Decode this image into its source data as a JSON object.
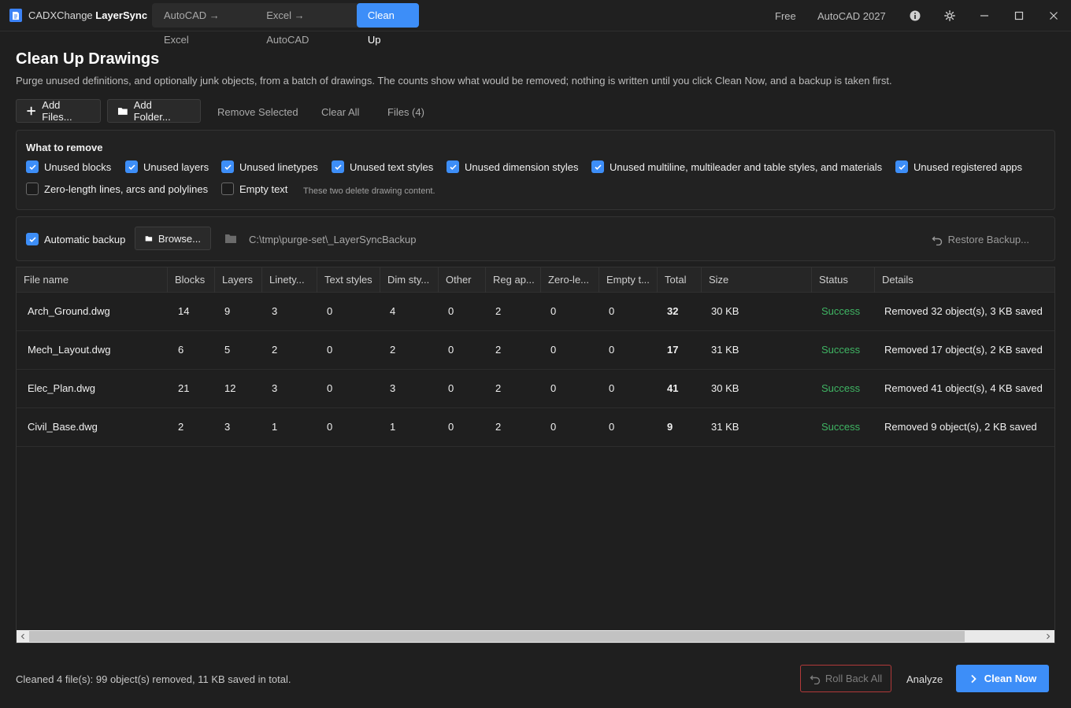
{
  "app": {
    "title_prefix": "CADXChange",
    "title_suffix": "LayerSync",
    "tabs": [
      {
        "label": "AutoCAD → Excel",
        "active": false
      },
      {
        "label": "Excel → AutoCAD",
        "active": false
      },
      {
        "label": "Clean Up",
        "active": true
      }
    ],
    "license": "Free",
    "autocad_version": "AutoCAD 2027",
    "accent_color": "#3d8ef8"
  },
  "header": {
    "title": "Clean Up Drawings",
    "subtitle": "Purge unused definitions, and optionally junk objects, from a batch of drawings. The counts show what would be removed; nothing is written until you click Clean Now, and a backup is taken first."
  },
  "toolbar": {
    "add_files": "Add Files...",
    "add_folder": "Add Folder...",
    "remove_selected": "Remove Selected",
    "clear_all": "Clear All",
    "files_count": "Files (4)"
  },
  "options": {
    "heading": "What to remove",
    "items": [
      {
        "label": "Unused blocks",
        "checked": true
      },
      {
        "label": "Unused layers",
        "checked": true
      },
      {
        "label": "Unused linetypes",
        "checked": true
      },
      {
        "label": "Unused text styles",
        "checked": true
      },
      {
        "label": "Unused dimension styles",
        "checked": true
      },
      {
        "label": "Unused multiline, multileader and table styles, and materials",
        "checked": true
      },
      {
        "label": "Unused registered apps",
        "checked": true
      },
      {
        "label": "Zero-length lines, arcs and polylines",
        "checked": false
      },
      {
        "label": "Empty text",
        "checked": false
      }
    ],
    "hint": "These two delete drawing content."
  },
  "backup": {
    "label": "Automatic backup",
    "checked": true,
    "browse": "Browse...",
    "path": "C:\\tmp\\purge-set\\_LayerSyncBackup",
    "restore": "Restore Backup..."
  },
  "table": {
    "columns": [
      "File name",
      "Blocks",
      "Layers",
      "Linety...",
      "Text styles",
      "Dim sty...",
      "Other",
      "Reg ap...",
      "Zero-le...",
      "Empty t...",
      "Total",
      "Size",
      "Status",
      "Details"
    ],
    "rows": [
      {
        "file": "Arch_Ground.dwg",
        "blocks": "14",
        "layers": "9",
        "linetypes": "3",
        "text_styles": "0",
        "dim_styles": "4",
        "other": "0",
        "reg_apps": "2",
        "zero_length": "0",
        "empty_text": "0",
        "total": "32",
        "size": "30 KB",
        "status": "Success",
        "details": "Removed 32 object(s), 3 KB saved"
      },
      {
        "file": "Mech_Layout.dwg",
        "blocks": "6",
        "layers": "5",
        "linetypes": "2",
        "text_styles": "0",
        "dim_styles": "2",
        "other": "0",
        "reg_apps": "2",
        "zero_length": "0",
        "empty_text": "0",
        "total": "17",
        "size": "31 KB",
        "status": "Success",
        "details": "Removed 17 object(s), 2 KB saved"
      },
      {
        "file": "Elec_Plan.dwg",
        "blocks": "21",
        "layers": "12",
        "linetypes": "3",
        "text_styles": "0",
        "dim_styles": "3",
        "other": "0",
        "reg_apps": "2",
        "zero_length": "0",
        "empty_text": "0",
        "total": "41",
        "size": "30 KB",
        "status": "Success",
        "details": "Removed 41 object(s), 4 KB saved"
      },
      {
        "file": "Civil_Base.dwg",
        "blocks": "2",
        "layers": "3",
        "linetypes": "1",
        "text_styles": "0",
        "dim_styles": "1",
        "other": "0",
        "reg_apps": "2",
        "zero_length": "0",
        "empty_text": "0",
        "total": "9",
        "size": "31 KB",
        "status": "Success",
        "details": "Removed 9 object(s), 2 KB saved"
      }
    ],
    "status_color": "#3fb463"
  },
  "footer": {
    "status": "Cleaned 4 file(s): 99 object(s) removed, 11 KB saved in total.",
    "roll_back": "Roll Back All",
    "analyze": "Analyze",
    "clean_now": "Clean Now"
  }
}
